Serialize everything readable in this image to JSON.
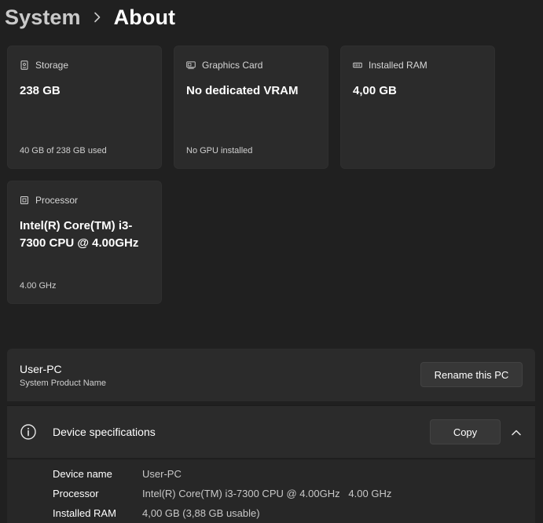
{
  "breadcrumb": {
    "parent": "System",
    "current": "About"
  },
  "cards": {
    "storage": {
      "label": "Storage",
      "value": "238 GB",
      "sub": "40 GB of 238 GB used",
      "icon": "storage-icon"
    },
    "gpu": {
      "label": "Graphics Card",
      "value": "No dedicated VRAM",
      "sub": "No GPU installed",
      "icon": "graphics-card-icon"
    },
    "ram": {
      "label": "Installed RAM",
      "value": "4,00 GB",
      "icon": "ram-icon"
    },
    "cpu": {
      "label": "Processor",
      "value": "Intel(R) Core(TM) i3-7300 CPU @ 4.00GHz",
      "sub": "4.00 GHz",
      "icon": "processor-icon"
    }
  },
  "pc": {
    "name": "User-PC",
    "sub": "System Product Name",
    "rename_label": "Rename this PC"
  },
  "specs": {
    "title": "Device specifications",
    "copy_label": "Copy",
    "rows": [
      {
        "key": "Device name",
        "value": "User-PC"
      },
      {
        "key": "Processor",
        "value": "Intel(R) Core(TM) i3-7300 CPU @ 4.00GHz   4.00 GHz"
      },
      {
        "key": "Installed RAM",
        "value": "4,00 GB (3,88 GB usable)"
      }
    ]
  },
  "colors": {
    "background": "#202020",
    "card": "#2b2b2b",
    "button": "#373737"
  }
}
